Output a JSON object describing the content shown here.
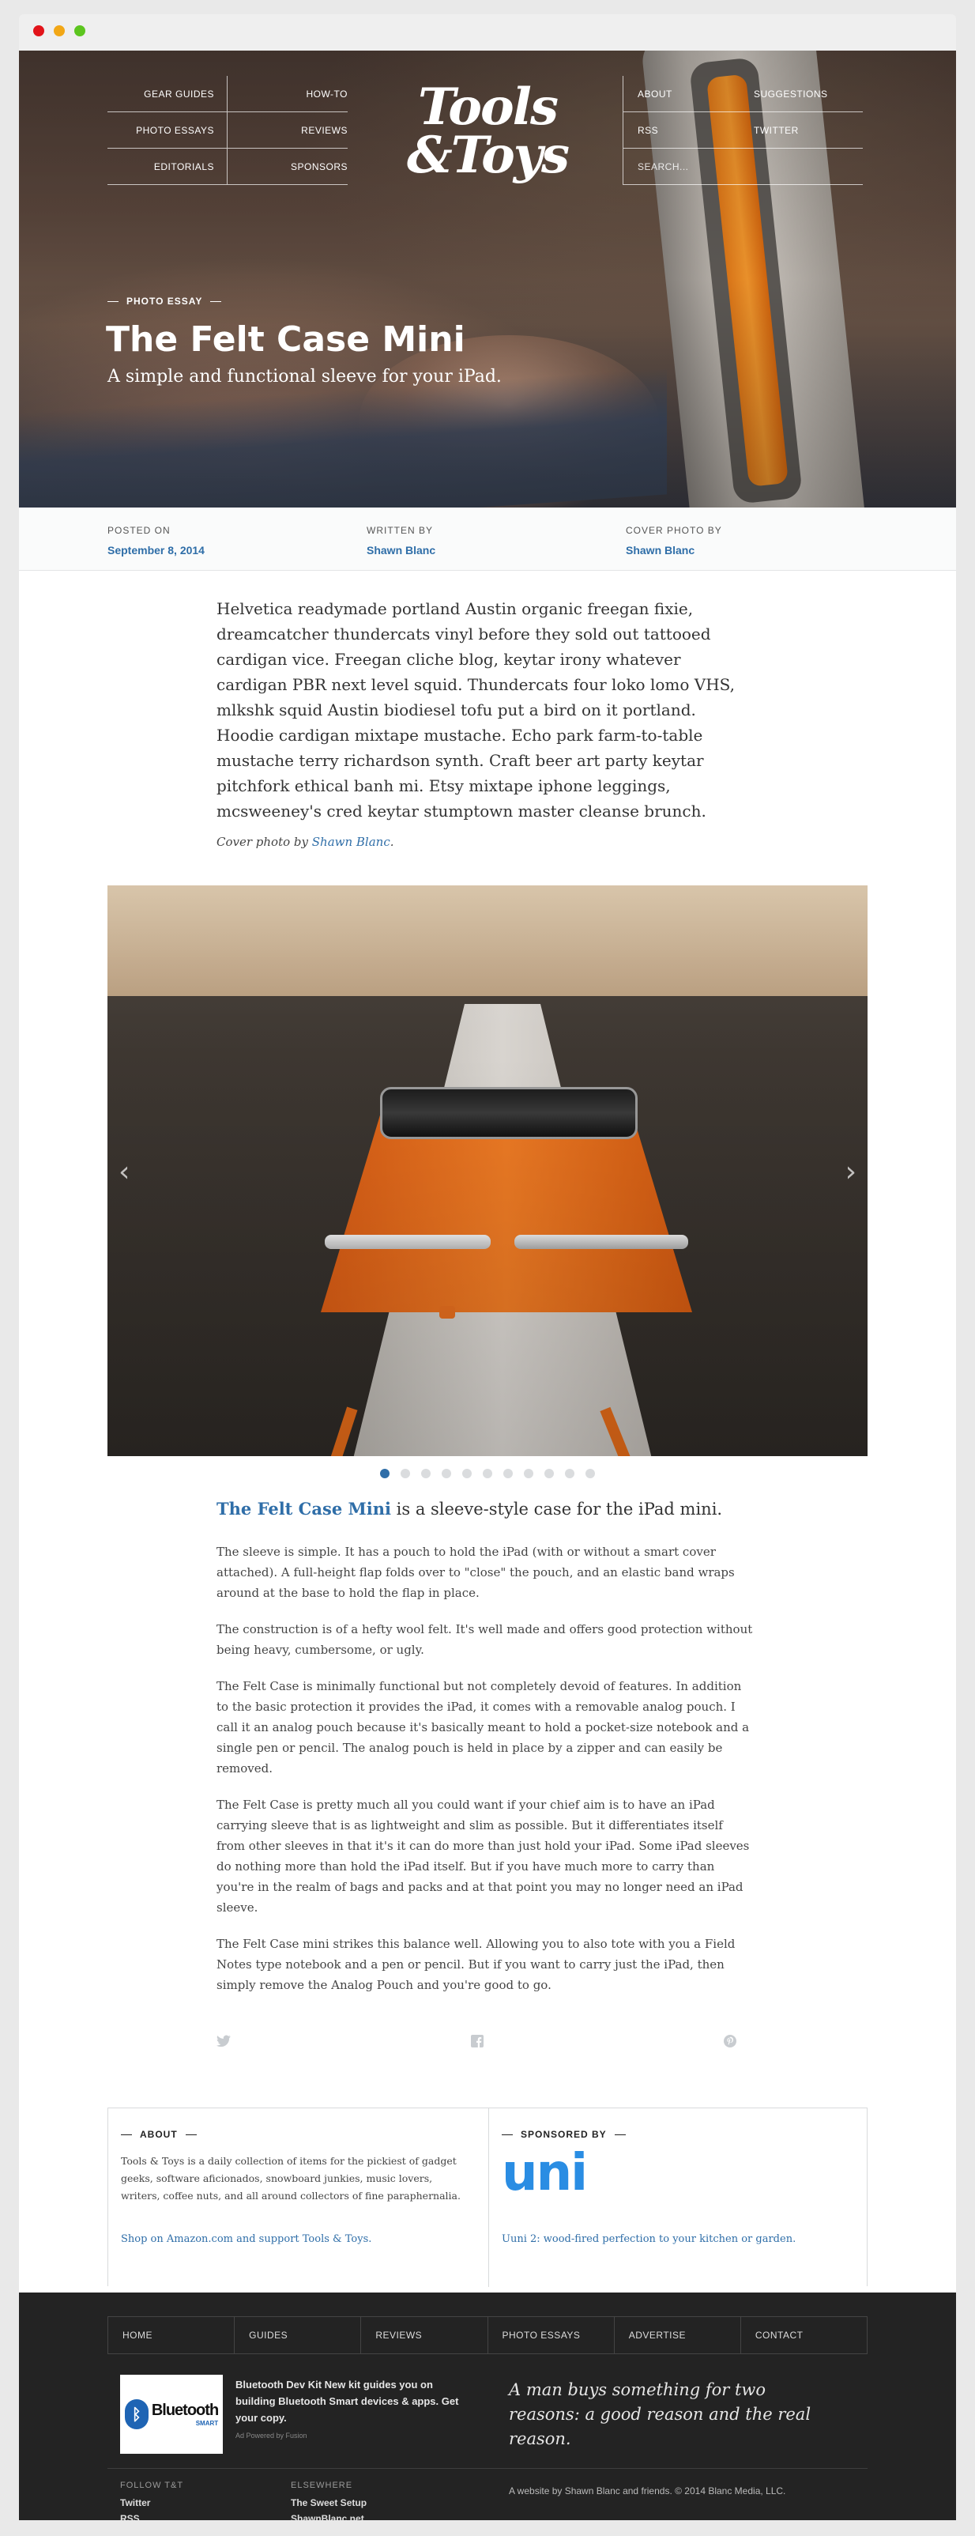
{
  "nav": {
    "left": [
      "Gear Guides",
      "How-To",
      "Photo Essays",
      "Reviews",
      "Editorials",
      "Sponsors"
    ],
    "right": [
      "About",
      "Suggestions",
      "RSS",
      "Twitter"
    ],
    "search_placeholder": "SEARCH..."
  },
  "logo": {
    "line1": "Tools",
    "line2": "&Toys"
  },
  "hero": {
    "eyebrow": "PHOTO ESSAY",
    "title": "The Felt Case Mini",
    "subtitle": "A simple and functional sleeve for your iPad."
  },
  "meta": {
    "posted_label": "Posted on",
    "posted_value": "September 8, 2014",
    "written_label": "Written by",
    "written_value": "Shawn Blanc",
    "cover_label": "Cover photo by",
    "cover_value": "Shawn Blanc"
  },
  "intro": "Helvetica readymade portland Austin organic freegan fixie, dreamcatcher thundercats vinyl before they sold out tattooed cardigan vice. Freegan cliche blog, keytar irony whatever cardigan PBR next level squid. Thundercats four loko lomo VHS, mlkshk squid Austin biodiesel tofu put a bird on it portland. Hoodie cardigan mixtape mustache. Echo park farm-to-table mustache terry richardson synth. Craft beer art party keytar pitchfork ethical banh mi. Etsy mixtape iphone leggings, mcsweeney's cred keytar stumptown master cleanse brunch.",
  "credit": {
    "prefix": "Cover photo by ",
    "name": "Shawn Blanc",
    "suffix": "."
  },
  "gallery": {
    "prev": "‹",
    "next": "›",
    "slides": 11,
    "active": 1
  },
  "article": {
    "lead_link": "The Felt Case Mini",
    "lead_rest": " is a sleeve-style case for the iPad mini.",
    "paragraphs": [
      "The sleeve is simple. It has a pouch to hold the iPad (with or without a smart cover attached). A full-height flap folds over to \"close\" the pouch, and an elastic band wraps around at the base to hold the flap in place.",
      "The construction is of a hefty wool felt. It's well made and offers good protection without being heavy, cumbersome, or ugly.",
      "The Felt Case is minimally functional but not completely devoid of features. In addition to the basic protection it provides the iPad, it comes with a removable analog pouch. I call it an analog pouch because it's basically meant to hold a pocket-size notebook and a single pen or pencil. The analog pouch is held in place by a zipper and can easily be removed.",
      "The Felt Case is pretty much all you could want if your chief aim is to have an iPad carrying sleeve that is as lightweight and slim as possible. But it differentiates itself from other sleeves in that it's it can do more than just hold your iPad. Some iPad sleeves do nothing more than hold the iPad itself. But if you have much more to carry than you're in the realm of bags and packs and at that point you may no longer need an iPad sleeve.",
      "The Felt Case mini strikes this balance well. Allowing you to also tote with you a Field Notes type notebook and a pen or pencil. But if you want to carry just the iPad, then simply remove the Analog Pouch and you're good to go."
    ]
  },
  "share": {
    "twitter": "🐦",
    "facebook": "f",
    "pinterest": "℗"
  },
  "about": {
    "label": "ABOUT",
    "text": "Tools & Toys is a daily collection of items for the pickiest of gadget geeks, software aficionados, snowboard junkies, music lovers, writers, coffee nuts, and all around collectors of fine paraphernalia.",
    "link": "Shop on Amazon.com and support Tools & Toys."
  },
  "sponsor": {
    "label": "SPONSORED BY",
    "logo": "uni",
    "link": "Uuni 2: wood-fired perfection to your kitchen or garden."
  },
  "footer": {
    "nav": [
      "Home",
      "Guides",
      "Reviews",
      "Photo Essays",
      "Advertise",
      "Contact"
    ],
    "ad_logo": "Bluetooth",
    "ad_logo_sub": "SMART",
    "ad_text": "Bluetooth Dev Kit New kit guides you on building Bluetooth Smart devices & apps. Get your copy.",
    "ad_powered": "Ad Powered by Fusion",
    "quote": "A man buys something for two reasons: a good reason and the real reason.",
    "follow_label": "Follow T&T",
    "follow_items": [
      "Twitter",
      "RSS"
    ],
    "elsewhere_label": "Elsewhere",
    "elsewhere_items": [
      "The Sweet Setup",
      "ShawnBlanc.net"
    ],
    "copyright": "A website by Shawn Blanc and friends. © 2014 Blanc Media, LLC."
  }
}
